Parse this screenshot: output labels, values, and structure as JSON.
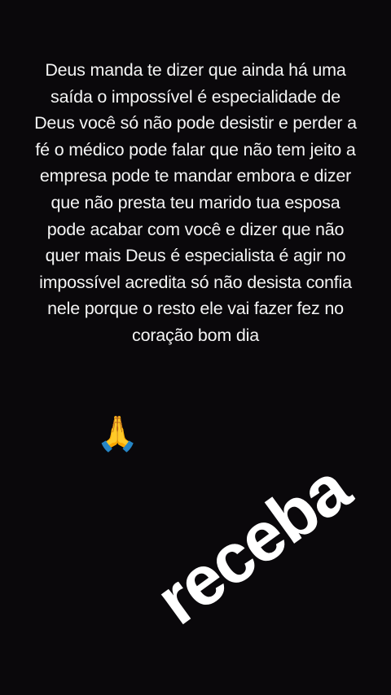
{
  "message": {
    "lines": [
      "Deus manda te dizer que ainda há uma",
      "saída o impossível é especialidade de",
      "Deus você só não pode desistir e perder a",
      "fé o médico pode falar que não tem jeito a",
      "empresa pode te mandar embora e dizer",
      "que não presta teu marido tua esposa",
      "pode acabar com você e dizer que não",
      "quer mais Deus é especialista é agir no",
      "impossível acredita só não desista confia",
      "nele porque o resto ele vai fazer fez no",
      "coração bom dia"
    ]
  },
  "emoji": {
    "icon": "praying-hands-icon",
    "glyph": "🙏"
  },
  "sticker": {
    "text": "receba",
    "color": "#ffffff"
  },
  "colors": {
    "background": "#0a080b",
    "text": "#f4f4f4"
  }
}
